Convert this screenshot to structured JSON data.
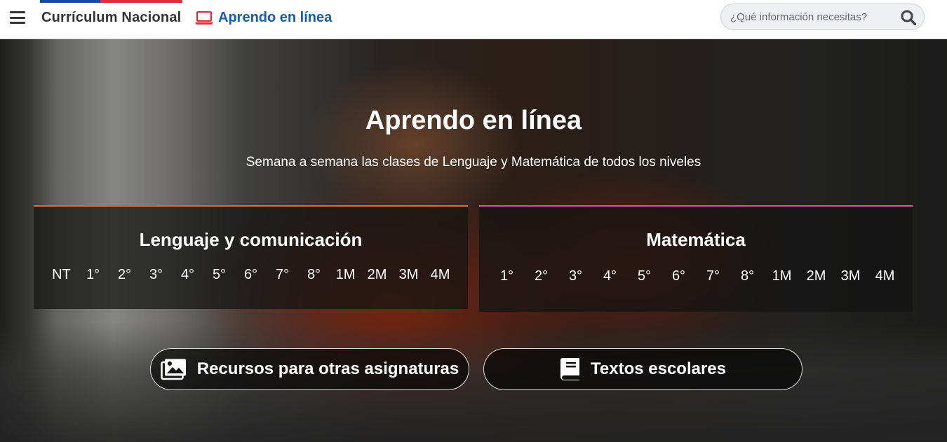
{
  "header": {
    "brand": "Currículum Nacional",
    "aprendo_link": "Aprendo en línea",
    "search_placeholder": "¿Qué información necesitas?",
    "colors": {
      "flag_blue": "#0f4ba3",
      "flag_red": "#e12d36",
      "link_blue": "#1a5bb0",
      "laptop_red": "#e12d36"
    },
    "icons": [
      "hamburger-menu-icon",
      "laptop-icon",
      "search-icon"
    ]
  },
  "hero": {
    "title": "Aprendo en línea",
    "subtitle": "Semana a semana las clases de Lenguaje y Matemática de todos los niveles",
    "cards": {
      "lenguaje": {
        "title": "Lenguaje y comunicación",
        "accent": "#e8643a",
        "levels": [
          "NT",
          "1°",
          "2°",
          "3°",
          "4°",
          "5°",
          "6°",
          "7°",
          "8°",
          "1M",
          "2M",
          "3M",
          "4M"
        ]
      },
      "matematica": {
        "title": "Matemática",
        "accent": "#e24a9a",
        "levels": [
          "1°",
          "2°",
          "3°",
          "4°",
          "5°",
          "6°",
          "7°",
          "8°",
          "1M",
          "2M",
          "3M",
          "4M"
        ]
      }
    },
    "buttons": {
      "recursos": {
        "label": "Recursos para otras asignaturas",
        "icon": "images-icon"
      },
      "textos": {
        "label": "Textos escolares",
        "icon": "book-icon"
      }
    }
  }
}
